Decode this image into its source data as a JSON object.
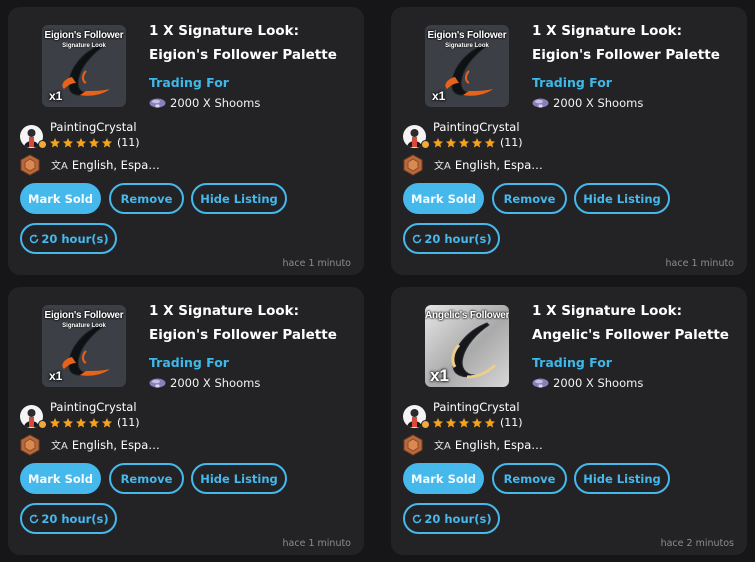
{
  "listings": [
    {
      "thumb_title": "Eigion's Follower",
      "thumb_subtitle": "Signature Look",
      "thumb_qty": "x1",
      "thumb_style": "dark",
      "title": "1 X Signature Look: Eigion's Follower Palette",
      "trading_label": "Trading For",
      "trading_item": "2000 X Shooms",
      "username": "PaintingCrystal",
      "rating_count": "(11)",
      "languages": "English, Espa…",
      "mark_sold_label": "Mark Sold",
      "remove_label": "Remove",
      "hide_label": "Hide Listing",
      "timer_label": "20 hour(s)",
      "time_ago": "hace 1 minuto"
    },
    {
      "thumb_title": "Eigion's Follower",
      "thumb_subtitle": "Signature Look",
      "thumb_qty": "x1",
      "thumb_style": "dark",
      "title": "1 X Signature Look: Eigion's Follower Palette",
      "trading_label": "Trading For",
      "trading_item": "2000 X Shooms",
      "username": "PaintingCrystal",
      "rating_count": "(11)",
      "languages": "English, Espa…",
      "mark_sold_label": "Mark Sold",
      "remove_label": "Remove",
      "hide_label": "Hide Listing",
      "timer_label": "20 hour(s)",
      "time_ago": "hace 1 minuto"
    },
    {
      "thumb_title": "Eigion's Follower",
      "thumb_subtitle": "Signature Look",
      "thumb_qty": "x1",
      "thumb_style": "dark",
      "title": "1 X Signature Look: Eigion's Follower Palette",
      "trading_label": "Trading For",
      "trading_item": "2000 X Shooms",
      "username": "PaintingCrystal",
      "rating_count": "(11)",
      "languages": "English, Espa…",
      "mark_sold_label": "Mark Sold",
      "remove_label": "Remove",
      "hide_label": "Hide Listing",
      "timer_label": "20 hour(s)",
      "time_ago": "hace 1 minuto"
    },
    {
      "thumb_title": "Angelic's Follower",
      "thumb_subtitle": "",
      "thumb_qty": "x1",
      "thumb_style": "light",
      "title": "1 X Signature Look: Angelic's Follower Palette",
      "trading_label": "Trading For",
      "trading_item": "2000 X Shooms",
      "username": "PaintingCrystal",
      "rating_count": "(11)",
      "languages": "English, Espa…",
      "mark_sold_label": "Mark Sold",
      "remove_label": "Remove",
      "hide_label": "Hide Listing",
      "timer_label": "20 hour(s)",
      "time_ago": "hace 2 minutos"
    }
  ],
  "colors": {
    "page_bg": "#161618",
    "card_bg": "#232326",
    "accent": "#45b8ec",
    "star": "#f7a21b",
    "muted_text": "#8d8d90"
  },
  "icons": {
    "shoom": "shoom-mushroom-icon",
    "star": "star-icon",
    "badge": "bronze-hexagon-badge-icon",
    "translate": "translate-icon",
    "refresh": "refresh-icon"
  }
}
